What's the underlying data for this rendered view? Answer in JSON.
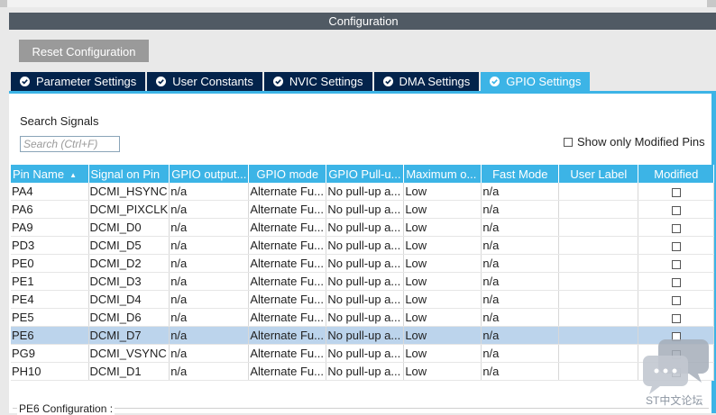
{
  "window": {
    "title": "Configuration"
  },
  "toolbar": {
    "reset_label": "Reset Configuration"
  },
  "tabs": [
    {
      "label": "Parameter Settings",
      "active": false
    },
    {
      "label": "User Constants",
      "active": false
    },
    {
      "label": "NVIC Settings",
      "active": false
    },
    {
      "label": "DMA Settings",
      "active": false
    },
    {
      "label": "GPIO Settings",
      "active": true
    }
  ],
  "search": {
    "label": "Search Signals",
    "placeholder": "Search (Ctrl+F)",
    "value": ""
  },
  "filter": {
    "show_modified_label": "Show only Modified Pins",
    "checked": false
  },
  "table": {
    "columns": [
      "Pin Name",
      "Signal on Pin",
      "GPIO output...",
      "GPIO mode",
      "GPIO Pull-u...",
      "Maximum o...",
      "Fast Mode",
      "User Label",
      "Modified"
    ],
    "sorted_column": "Pin Name",
    "rows": [
      {
        "pin": "PA4",
        "signal": "DCMI_HSYNC",
        "output": "n/a",
        "mode": "Alternate Fu...",
        "pull": "No pull-up a...",
        "max": "Low",
        "fast": "n/a",
        "label": "",
        "modified": false
      },
      {
        "pin": "PA6",
        "signal": "DCMI_PIXCLK",
        "output": "n/a",
        "mode": "Alternate Fu...",
        "pull": "No pull-up a...",
        "max": "Low",
        "fast": "n/a",
        "label": "",
        "modified": false
      },
      {
        "pin": "PA9",
        "signal": "DCMI_D0",
        "output": "n/a",
        "mode": "Alternate Fu...",
        "pull": "No pull-up a...",
        "max": "Low",
        "fast": "n/a",
        "label": "",
        "modified": false
      },
      {
        "pin": "PD3",
        "signal": "DCMI_D5",
        "output": "n/a",
        "mode": "Alternate Fu...",
        "pull": "No pull-up a...",
        "max": "Low",
        "fast": "n/a",
        "label": "",
        "modified": false
      },
      {
        "pin": "PE0",
        "signal": "DCMI_D2",
        "output": "n/a",
        "mode": "Alternate Fu...",
        "pull": "No pull-up a...",
        "max": "Low",
        "fast": "n/a",
        "label": "",
        "modified": false
      },
      {
        "pin": "PE1",
        "signal": "DCMI_D3",
        "output": "n/a",
        "mode": "Alternate Fu...",
        "pull": "No pull-up a...",
        "max": "Low",
        "fast": "n/a",
        "label": "",
        "modified": false
      },
      {
        "pin": "PE4",
        "signal": "DCMI_D4",
        "output": "n/a",
        "mode": "Alternate Fu...",
        "pull": "No pull-up a...",
        "max": "Low",
        "fast": "n/a",
        "label": "",
        "modified": false
      },
      {
        "pin": "PE5",
        "signal": "DCMI_D6",
        "output": "n/a",
        "mode": "Alternate Fu...",
        "pull": "No pull-up a...",
        "max": "Low",
        "fast": "n/a",
        "label": "",
        "modified": false
      },
      {
        "pin": "PE6",
        "signal": "DCMI_D7",
        "output": "n/a",
        "mode": "Alternate Fu...",
        "pull": "No pull-up a...",
        "max": "Low",
        "fast": "n/a",
        "label": "",
        "modified": false,
        "selected": true
      },
      {
        "pin": "PG9",
        "signal": "DCMI_VSYNC",
        "output": "n/a",
        "mode": "Alternate Fu...",
        "pull": "No pull-up a...",
        "max": "Low",
        "fast": "n/a",
        "label": "",
        "modified": false
      },
      {
        "pin": "PH10",
        "signal": "DCMI_D1",
        "output": "n/a",
        "mode": "Alternate Fu...",
        "pull": "No pull-up a...",
        "max": "Low",
        "fast": "n/a",
        "label": "",
        "modified": false
      }
    ]
  },
  "pin_config": {
    "label": "PE6 Configuration :"
  },
  "watermark": {
    "text": "ST中文论坛"
  },
  "colors": {
    "accent": "#3cb4e6",
    "tab_dark": "#03234b",
    "title_bar": "#505a64",
    "selected_row": "#bcd4ec"
  }
}
